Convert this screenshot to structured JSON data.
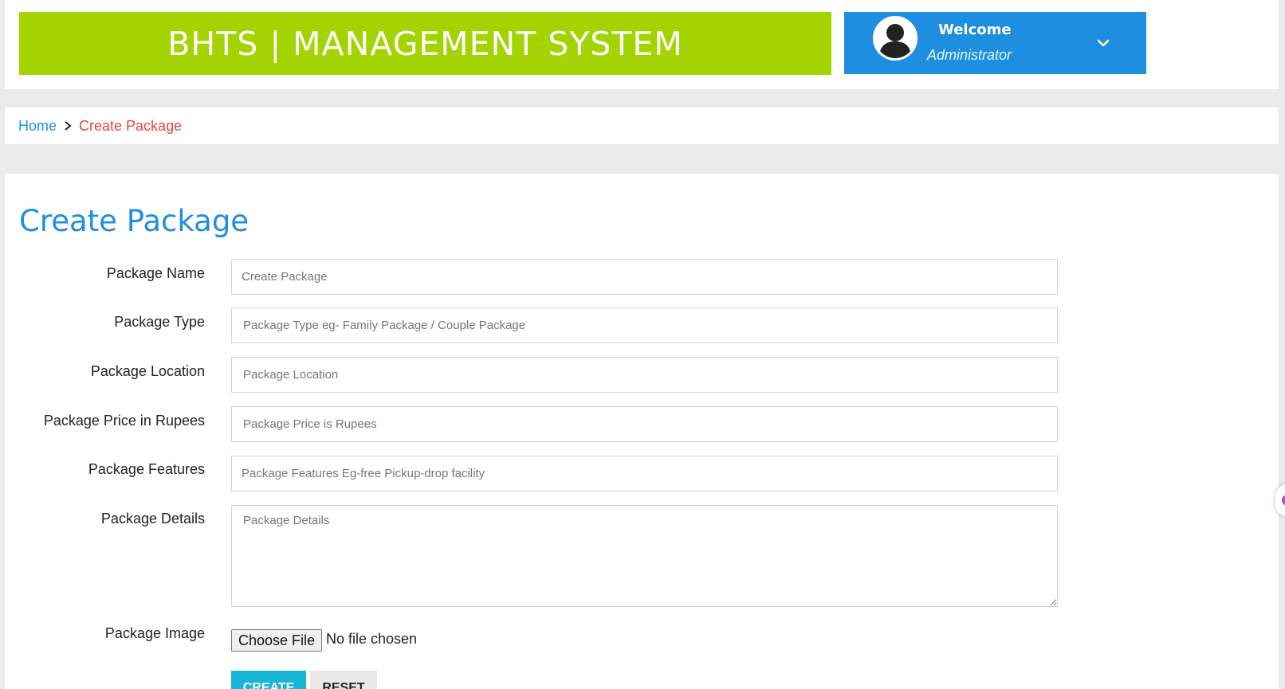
{
  "header": {
    "brand": "BHTS | MANAGEMENT SYSTEM",
    "user": {
      "welcome": "Welcome",
      "role": "Administrator"
    },
    "colors": {
      "brand_bg": "#a3d400",
      "user_bg": "#1e8fe0"
    }
  },
  "breadcrumb": {
    "home": "Home",
    "current": "Create Package"
  },
  "form": {
    "title": "Create Package",
    "fields": [
      {
        "label": "Package Name",
        "placeholder": "Create Package"
      },
      {
        "label": "Package Type",
        "placeholder": "Package Type eg- Family Package / Couple Package"
      },
      {
        "label": "Package Location",
        "placeholder": "Package Location"
      },
      {
        "label": "Package Price in Rupees",
        "placeholder": "Package Price is Rupees"
      },
      {
        "label": "Package Features",
        "placeholder": "Package Features Eg-free Pickup-drop facility"
      },
      {
        "label": "Package Details",
        "placeholder": "Package Details"
      }
    ],
    "image": {
      "label": "Package Image",
      "button": "Choose File",
      "status": "No file chosen"
    },
    "actions": {
      "create": "CREATE",
      "reset": "RESET"
    }
  }
}
